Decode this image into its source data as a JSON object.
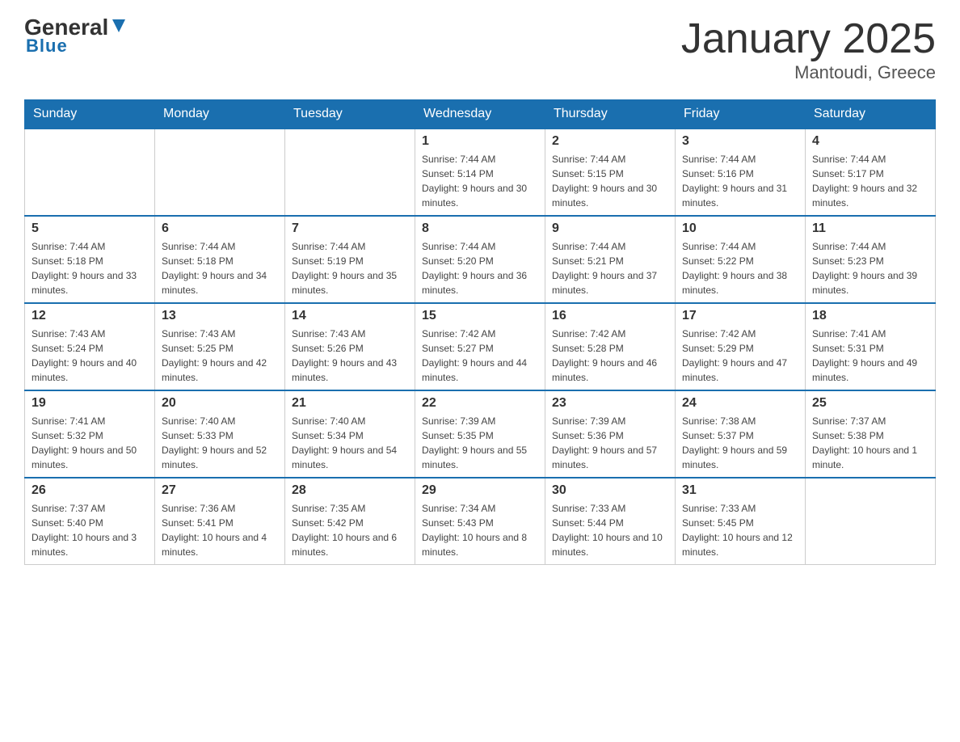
{
  "header": {
    "logo_general": "General",
    "logo_blue": "Blue",
    "month_title": "January 2025",
    "location": "Mantoudi, Greece"
  },
  "days_of_week": [
    "Sunday",
    "Monday",
    "Tuesday",
    "Wednesday",
    "Thursday",
    "Friday",
    "Saturday"
  ],
  "weeks": [
    [
      {
        "day": "",
        "sunrise": "",
        "sunset": "",
        "daylight": ""
      },
      {
        "day": "",
        "sunrise": "",
        "sunset": "",
        "daylight": ""
      },
      {
        "day": "",
        "sunrise": "",
        "sunset": "",
        "daylight": ""
      },
      {
        "day": "1",
        "sunrise": "Sunrise: 7:44 AM",
        "sunset": "Sunset: 5:14 PM",
        "daylight": "Daylight: 9 hours and 30 minutes."
      },
      {
        "day": "2",
        "sunrise": "Sunrise: 7:44 AM",
        "sunset": "Sunset: 5:15 PM",
        "daylight": "Daylight: 9 hours and 30 minutes."
      },
      {
        "day": "3",
        "sunrise": "Sunrise: 7:44 AM",
        "sunset": "Sunset: 5:16 PM",
        "daylight": "Daylight: 9 hours and 31 minutes."
      },
      {
        "day": "4",
        "sunrise": "Sunrise: 7:44 AM",
        "sunset": "Sunset: 5:17 PM",
        "daylight": "Daylight: 9 hours and 32 minutes."
      }
    ],
    [
      {
        "day": "5",
        "sunrise": "Sunrise: 7:44 AM",
        "sunset": "Sunset: 5:18 PM",
        "daylight": "Daylight: 9 hours and 33 minutes."
      },
      {
        "day": "6",
        "sunrise": "Sunrise: 7:44 AM",
        "sunset": "Sunset: 5:18 PM",
        "daylight": "Daylight: 9 hours and 34 minutes."
      },
      {
        "day": "7",
        "sunrise": "Sunrise: 7:44 AM",
        "sunset": "Sunset: 5:19 PM",
        "daylight": "Daylight: 9 hours and 35 minutes."
      },
      {
        "day": "8",
        "sunrise": "Sunrise: 7:44 AM",
        "sunset": "Sunset: 5:20 PM",
        "daylight": "Daylight: 9 hours and 36 minutes."
      },
      {
        "day": "9",
        "sunrise": "Sunrise: 7:44 AM",
        "sunset": "Sunset: 5:21 PM",
        "daylight": "Daylight: 9 hours and 37 minutes."
      },
      {
        "day": "10",
        "sunrise": "Sunrise: 7:44 AM",
        "sunset": "Sunset: 5:22 PM",
        "daylight": "Daylight: 9 hours and 38 minutes."
      },
      {
        "day": "11",
        "sunrise": "Sunrise: 7:44 AM",
        "sunset": "Sunset: 5:23 PM",
        "daylight": "Daylight: 9 hours and 39 minutes."
      }
    ],
    [
      {
        "day": "12",
        "sunrise": "Sunrise: 7:43 AM",
        "sunset": "Sunset: 5:24 PM",
        "daylight": "Daylight: 9 hours and 40 minutes."
      },
      {
        "day": "13",
        "sunrise": "Sunrise: 7:43 AM",
        "sunset": "Sunset: 5:25 PM",
        "daylight": "Daylight: 9 hours and 42 minutes."
      },
      {
        "day": "14",
        "sunrise": "Sunrise: 7:43 AM",
        "sunset": "Sunset: 5:26 PM",
        "daylight": "Daylight: 9 hours and 43 minutes."
      },
      {
        "day": "15",
        "sunrise": "Sunrise: 7:42 AM",
        "sunset": "Sunset: 5:27 PM",
        "daylight": "Daylight: 9 hours and 44 minutes."
      },
      {
        "day": "16",
        "sunrise": "Sunrise: 7:42 AM",
        "sunset": "Sunset: 5:28 PM",
        "daylight": "Daylight: 9 hours and 46 minutes."
      },
      {
        "day": "17",
        "sunrise": "Sunrise: 7:42 AM",
        "sunset": "Sunset: 5:29 PM",
        "daylight": "Daylight: 9 hours and 47 minutes."
      },
      {
        "day": "18",
        "sunrise": "Sunrise: 7:41 AM",
        "sunset": "Sunset: 5:31 PM",
        "daylight": "Daylight: 9 hours and 49 minutes."
      }
    ],
    [
      {
        "day": "19",
        "sunrise": "Sunrise: 7:41 AM",
        "sunset": "Sunset: 5:32 PM",
        "daylight": "Daylight: 9 hours and 50 minutes."
      },
      {
        "day": "20",
        "sunrise": "Sunrise: 7:40 AM",
        "sunset": "Sunset: 5:33 PM",
        "daylight": "Daylight: 9 hours and 52 minutes."
      },
      {
        "day": "21",
        "sunrise": "Sunrise: 7:40 AM",
        "sunset": "Sunset: 5:34 PM",
        "daylight": "Daylight: 9 hours and 54 minutes."
      },
      {
        "day": "22",
        "sunrise": "Sunrise: 7:39 AM",
        "sunset": "Sunset: 5:35 PM",
        "daylight": "Daylight: 9 hours and 55 minutes."
      },
      {
        "day": "23",
        "sunrise": "Sunrise: 7:39 AM",
        "sunset": "Sunset: 5:36 PM",
        "daylight": "Daylight: 9 hours and 57 minutes."
      },
      {
        "day": "24",
        "sunrise": "Sunrise: 7:38 AM",
        "sunset": "Sunset: 5:37 PM",
        "daylight": "Daylight: 9 hours and 59 minutes."
      },
      {
        "day": "25",
        "sunrise": "Sunrise: 7:37 AM",
        "sunset": "Sunset: 5:38 PM",
        "daylight": "Daylight: 10 hours and 1 minute."
      }
    ],
    [
      {
        "day": "26",
        "sunrise": "Sunrise: 7:37 AM",
        "sunset": "Sunset: 5:40 PM",
        "daylight": "Daylight: 10 hours and 3 minutes."
      },
      {
        "day": "27",
        "sunrise": "Sunrise: 7:36 AM",
        "sunset": "Sunset: 5:41 PM",
        "daylight": "Daylight: 10 hours and 4 minutes."
      },
      {
        "day": "28",
        "sunrise": "Sunrise: 7:35 AM",
        "sunset": "Sunset: 5:42 PM",
        "daylight": "Daylight: 10 hours and 6 minutes."
      },
      {
        "day": "29",
        "sunrise": "Sunrise: 7:34 AM",
        "sunset": "Sunset: 5:43 PM",
        "daylight": "Daylight: 10 hours and 8 minutes."
      },
      {
        "day": "30",
        "sunrise": "Sunrise: 7:33 AM",
        "sunset": "Sunset: 5:44 PM",
        "daylight": "Daylight: 10 hours and 10 minutes."
      },
      {
        "day": "31",
        "sunrise": "Sunrise: 7:33 AM",
        "sunset": "Sunset: 5:45 PM",
        "daylight": "Daylight: 10 hours and 12 minutes."
      },
      {
        "day": "",
        "sunrise": "",
        "sunset": "",
        "daylight": ""
      }
    ]
  ]
}
